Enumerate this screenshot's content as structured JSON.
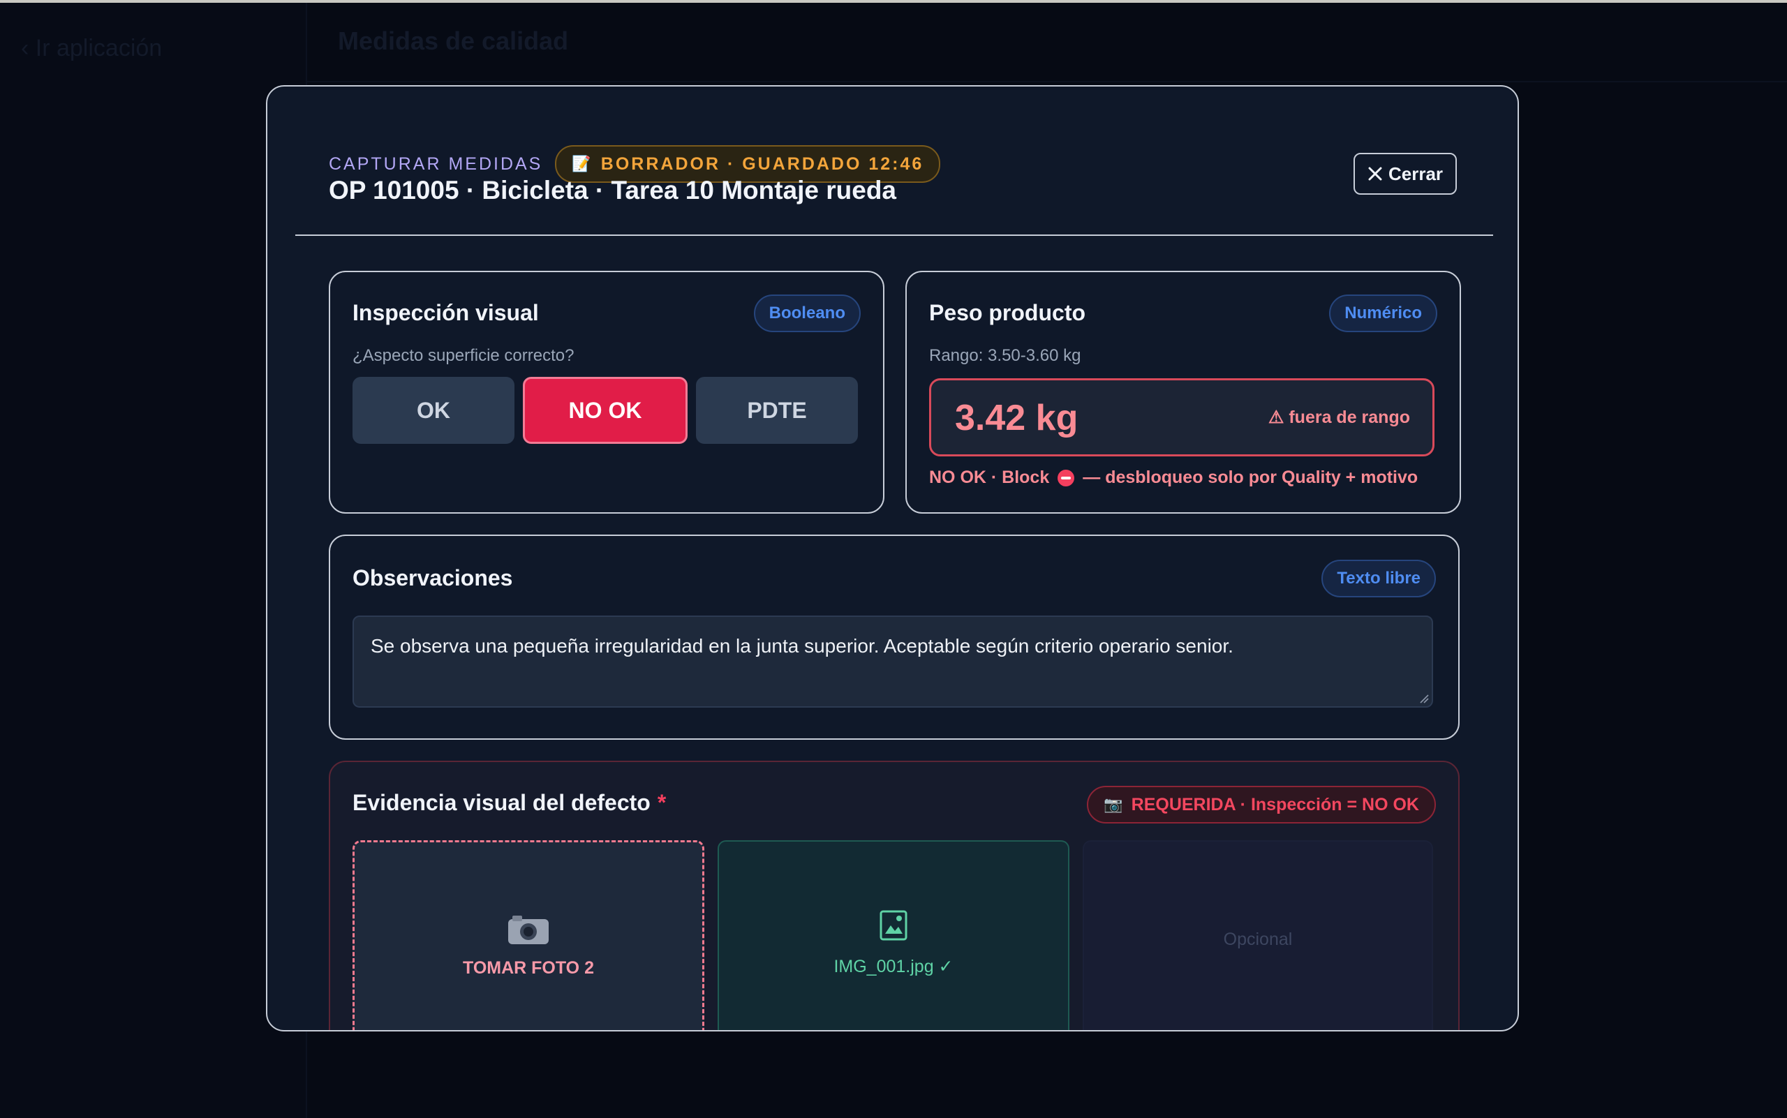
{
  "background": {
    "back_link": "‹ Ir aplicación",
    "page_title": "Medidas de calidad"
  },
  "modal": {
    "eyebrow": "CAPTURAR MEDIDAS",
    "draft_badge": "BORRADOR · GUARDADO 12:46",
    "title": "OP 101005 · Bicicleta · Tarea 10 Montaje rueda",
    "close_label": "Cerrar"
  },
  "inspection": {
    "title": "Inspección visual",
    "type": "Booleano",
    "question": "¿Aspecto superficie correcto?",
    "options": [
      "OK",
      "NO OK",
      "PDTE"
    ],
    "selected": "NO OK"
  },
  "weight": {
    "title": "Peso producto",
    "type": "Numérico",
    "range": "Rango: 3.50-3.60 kg",
    "value": "3.42 kg",
    "warning": "fuera de rango",
    "note_prefix": "NO OK · Block",
    "note_suffix": "— desbloqueo solo por Quality + motivo"
  },
  "observations": {
    "title": "Observaciones",
    "type": "Texto libre",
    "text": "Se observa una pequeña irregularidad en la junta superior. Aceptable según criterio operario senior."
  },
  "evidence": {
    "title": "Evidencia visual del defecto",
    "required_marker": "*",
    "required_badge": "REQUERIDA · Inspección = NO OK",
    "slots": [
      {
        "label": "TOMAR FOTO 2",
        "icon": "camera-icon"
      },
      {
        "label": "IMG_001.jpg ✓",
        "icon": "image-icon"
      },
      {
        "label": "Opcional"
      }
    ]
  },
  "colors": {
    "accent_danger": "#e11d48",
    "accent_warning": "#f3a53b",
    "accent_info": "#4f8df2",
    "accent_success": "#5fd3a6"
  }
}
